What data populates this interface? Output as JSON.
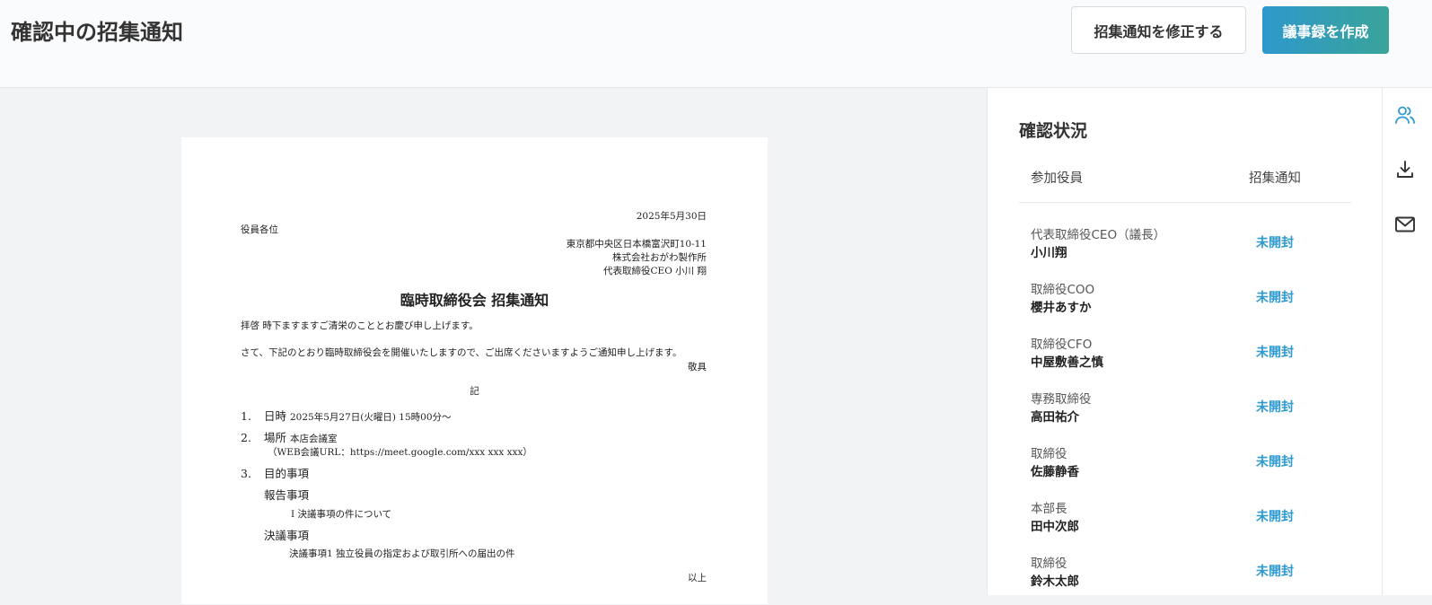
{
  "header": {
    "title": "確認中の招集通知",
    "edit_button": "招集通知を修正する",
    "create_button": "議事録を作成"
  },
  "document": {
    "date": "2025年5月30日",
    "addressee": "役員各位",
    "address": "東京都中央区日本橋富沢町10-11",
    "company": "株式会社おがわ製作所",
    "representative": "代表取締役CEO 小川 翔",
    "title": "臨時取締役会 招集通知",
    "greeting": "拝啓 時下ますますご清栄のこととお慶び申し上げます。",
    "body": "さて、下記のとおり臨時取締役会を開催いたしますので、ご出席くださいますようご通知申し上げます。",
    "closing": "敬具",
    "ki": "記",
    "item1_num": "1.",
    "item1_label": "日時",
    "item1_value": "2025年5月27日(火曜日) 15時00分～",
    "item2_num": "2.",
    "item2_label": "場所",
    "item2_value": "本店会議室",
    "item2_url": "（WEB会議URL：https://meet.google.com/xxx xxx xxx）",
    "item3_num": "3.",
    "item3_label": "目的事項",
    "report_heading": "報告事項",
    "report_item": "Ⅰ 決議事項の件について",
    "resolution_heading": "決議事項",
    "resolution_item": "決議事項1 独立役員の指定および取引所への届出の件",
    "end": "以上"
  },
  "panel": {
    "title": "確認状況",
    "col_members": "参加役員",
    "col_notice": "招集通知",
    "rows": [
      {
        "role": "代表取締役CEO（議長）",
        "name": "小川翔",
        "status": "未開封"
      },
      {
        "role": "取締役COO",
        "name": "櫻井あすか",
        "status": "未開封"
      },
      {
        "role": "取締役CFO",
        "name": "中屋敷善之慎",
        "status": "未開封"
      },
      {
        "role": "専務取締役",
        "name": "高田祐介",
        "status": "未開封"
      },
      {
        "role": "取締役",
        "name": "佐藤静香",
        "status": "未開封"
      },
      {
        "role": "本部長",
        "name": "田中次郎",
        "status": "未開封"
      },
      {
        "role": "取締役",
        "name": "鈴木太郎",
        "status": "未開封"
      }
    ]
  },
  "sidebar_icons": [
    "users-icon",
    "download-icon",
    "mail-icon"
  ],
  "colors": {
    "accent": "#2e9ad0",
    "button_gradient_start": "#2e98cc",
    "button_gradient_end": "#3aa49a"
  }
}
